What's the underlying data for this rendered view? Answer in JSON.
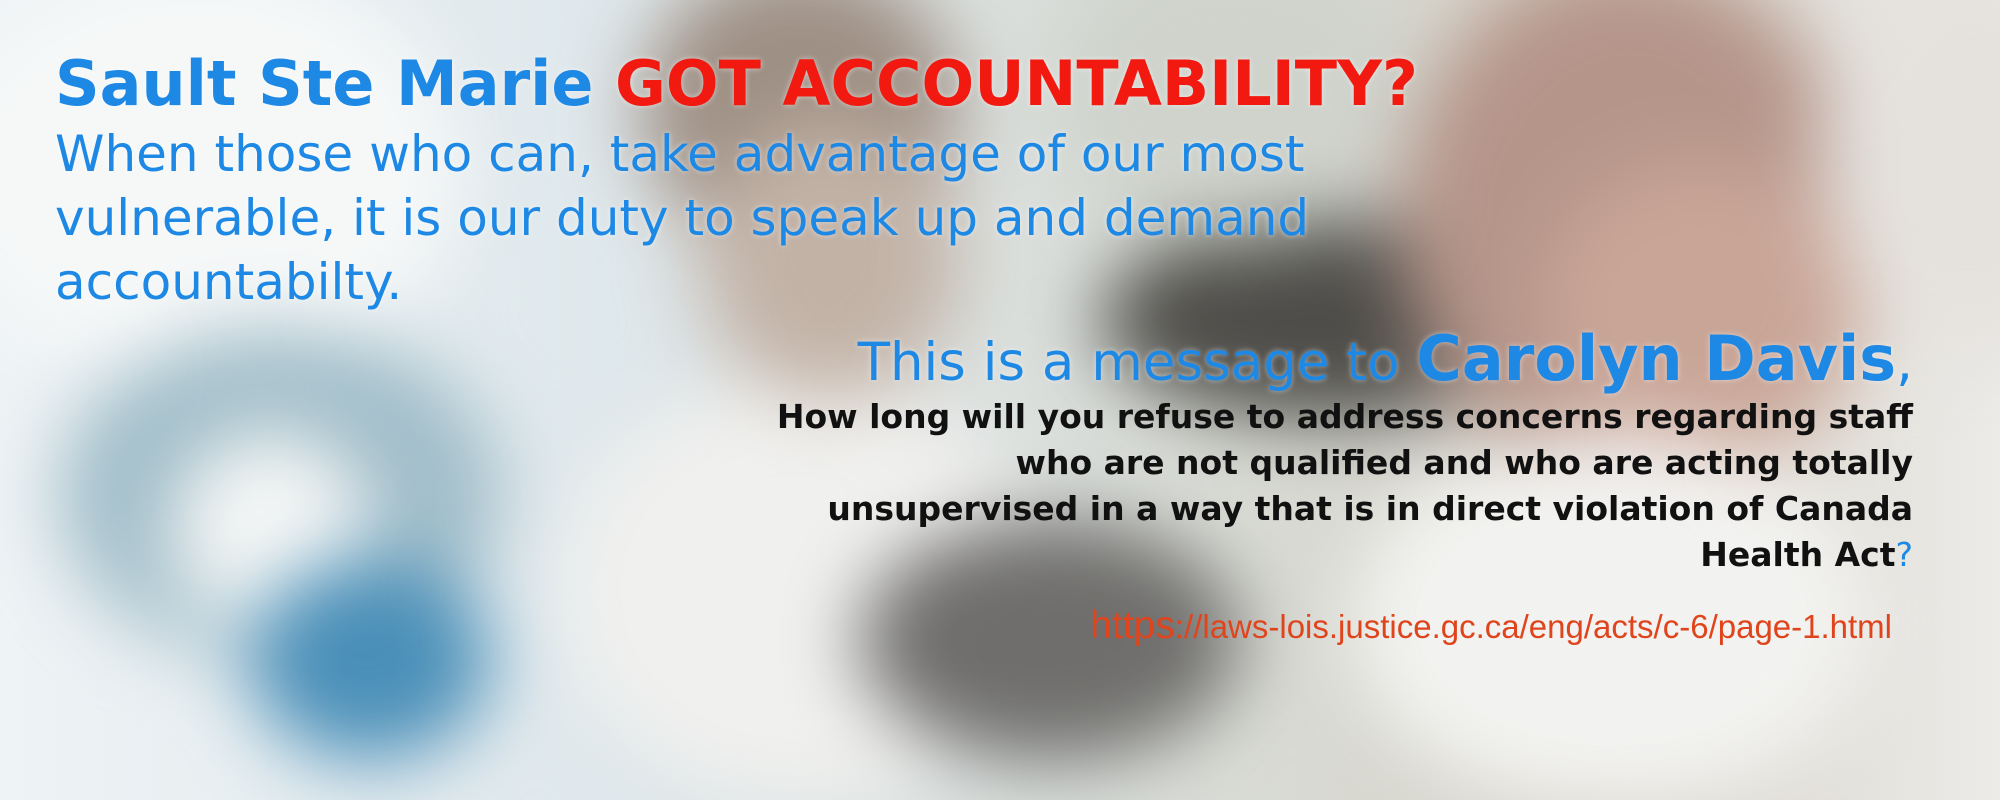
{
  "headline": {
    "part1": "Sault Ste Marie ",
    "part2": "GOT ACCOUNTABILITY?"
  },
  "intro": "When those who can, take advantage of our most vulnerable, it is our duty to speak up and demand accountabilty.",
  "message": {
    "prefix": "This is a message to ",
    "recipient": "Carolyn Davis",
    "suffix": ","
  },
  "question": {
    "text": "How long will you refuse to address concerns regarding staff who are not qualified and who are acting totally unsupervised in a way that is in direct violation of Canada Health Act",
    "mark": "?"
  },
  "link": {
    "prefix": "https",
    "rest": "://laws-lois.justice.gc.ca/eng/acts/c-6/page-1.html"
  },
  "colors": {
    "accent_blue": "#1e88e5",
    "headline_red": "#f21a10",
    "link_orange": "#e0441c",
    "body_text": "#111111"
  },
  "background": {
    "description_icon": "blurred-laboratory-photo"
  }
}
